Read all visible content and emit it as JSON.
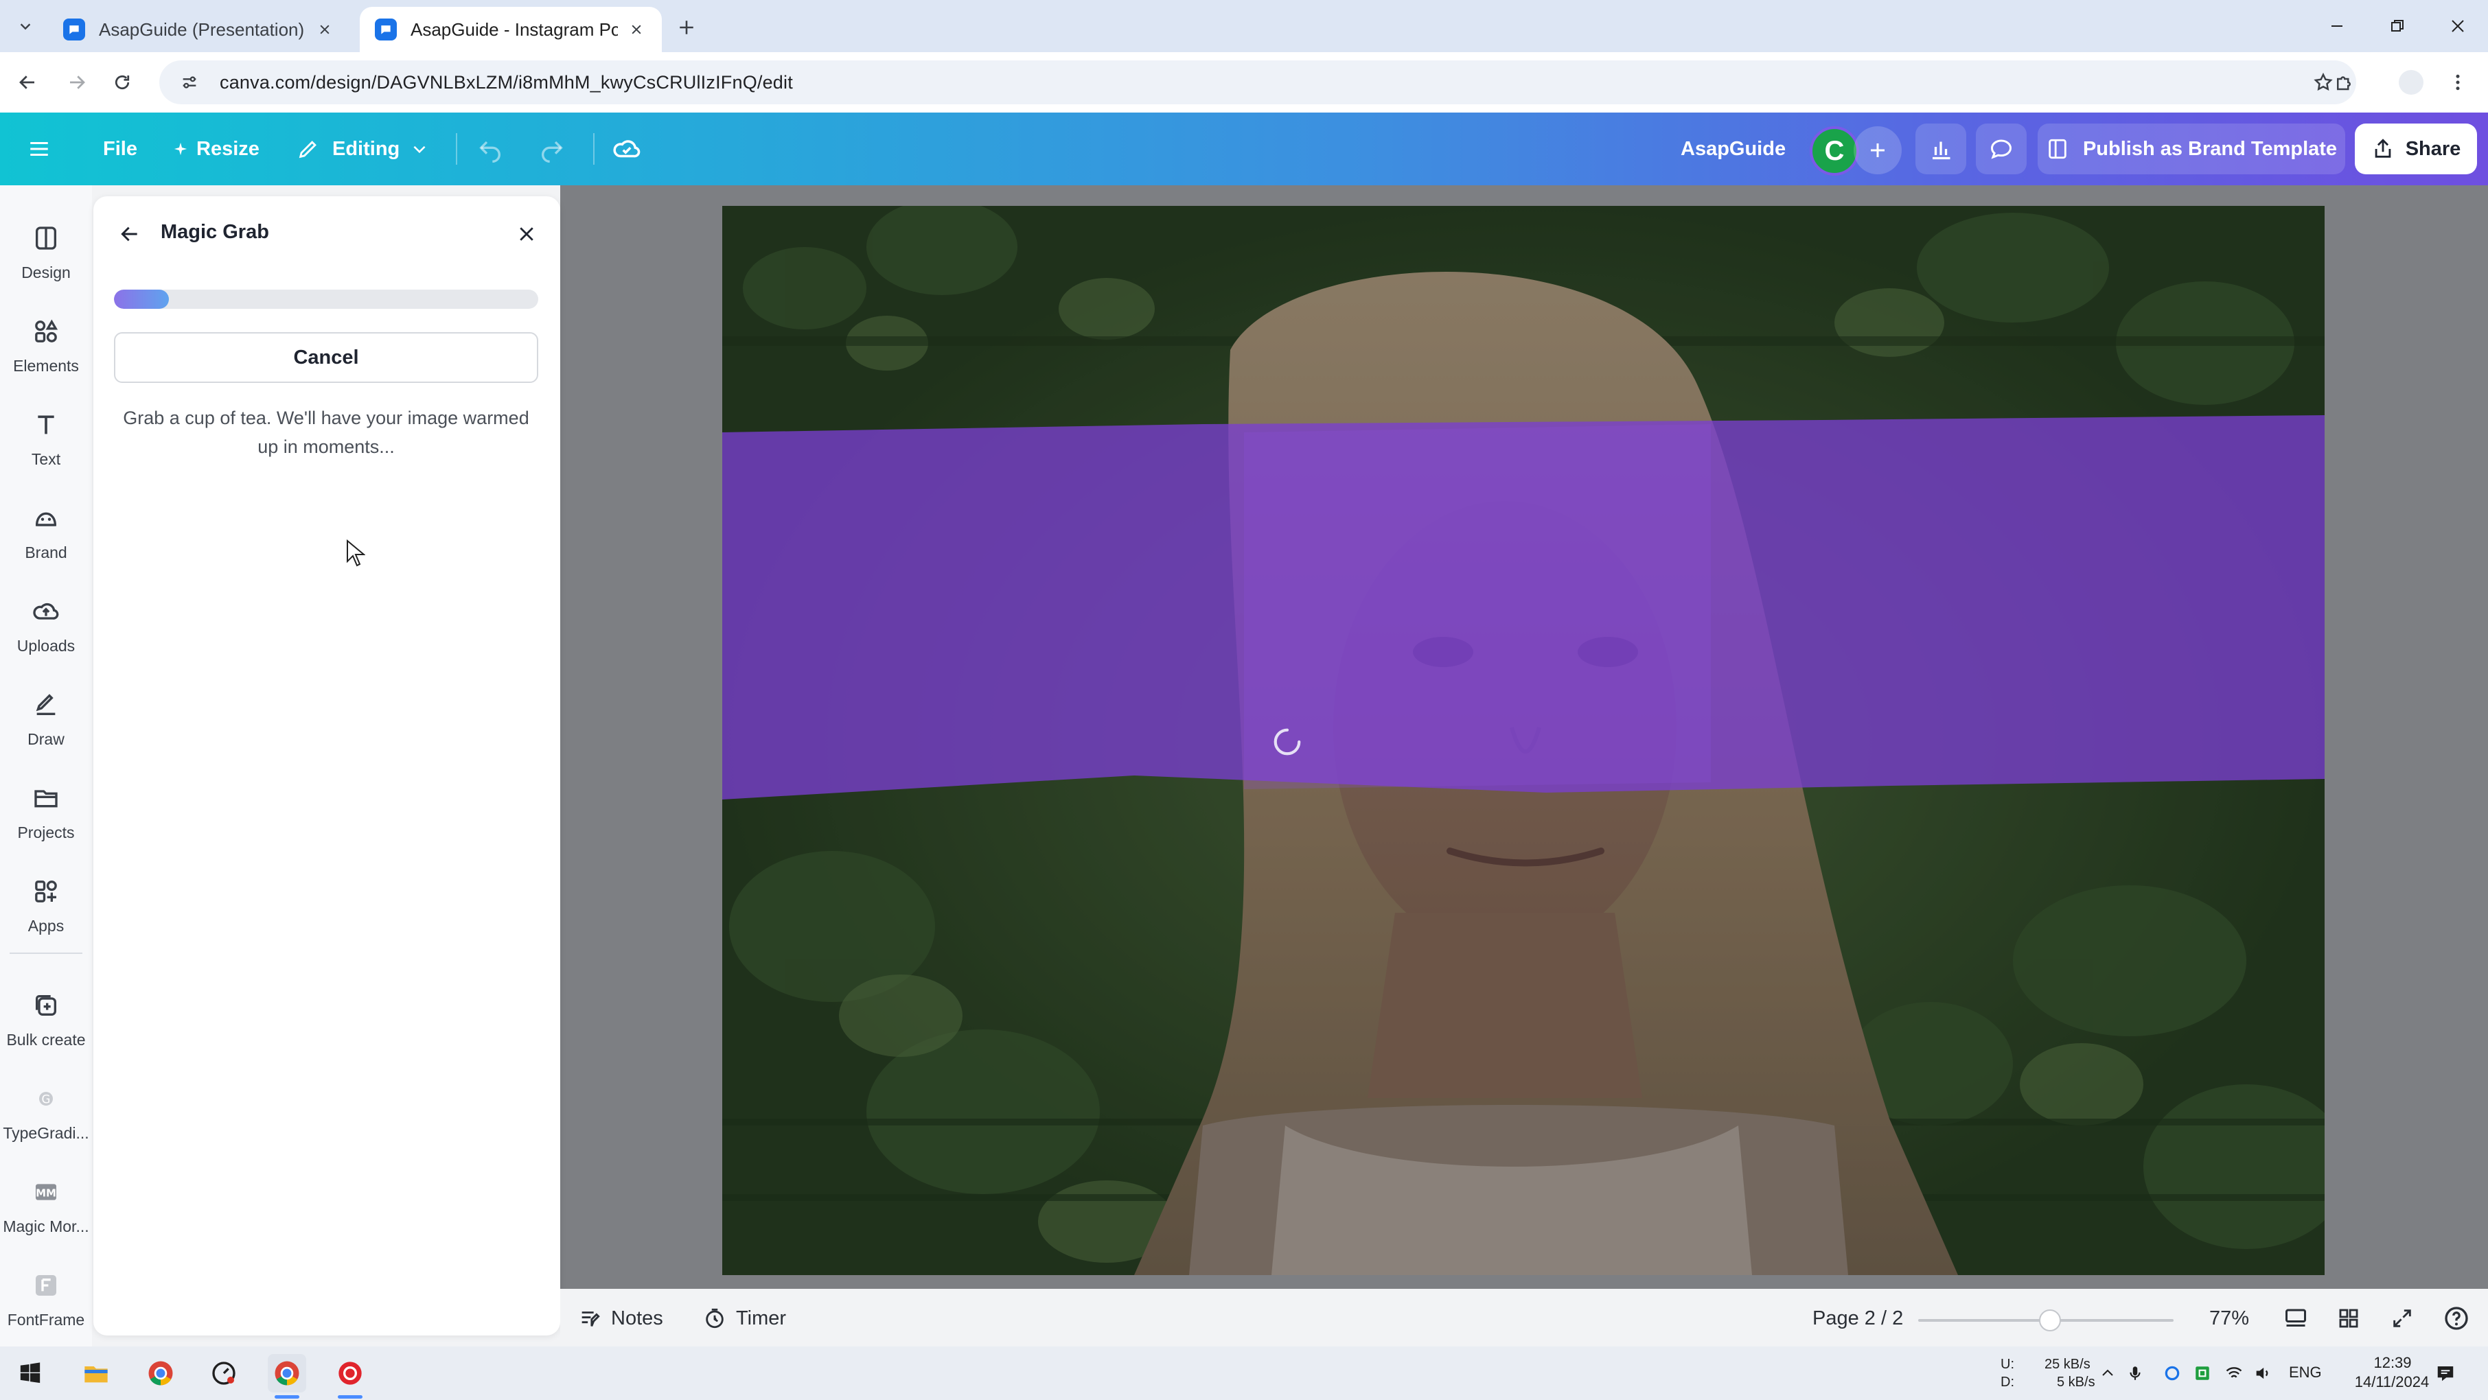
{
  "browser": {
    "tabs": [
      {
        "title": "AsapGuide (Presentation) - Pre",
        "active": false,
        "icon": "canva-favicon"
      },
      {
        "title": "AsapGuide - Instagram Post",
        "active": true,
        "icon": "canva-favicon"
      }
    ],
    "url": "canva.com/design/DAGVNLBxLZM/i8mMhM_kwyCsCRUlIzIFnQ/edit"
  },
  "header": {
    "file_label": "File",
    "resize_label": "Resize",
    "editing_label": "Editing",
    "project_name": "AsapGuide",
    "avatar_letter": "C",
    "publish_label": "Publish as Brand Template",
    "share_label": "Share",
    "colors": {
      "gradient_start": "#11c3d3",
      "gradient_end": "#6e4fe0"
    }
  },
  "rail": {
    "items": [
      {
        "label": "Design",
        "icon": "design-icon"
      },
      {
        "label": "Elements",
        "icon": "elements-icon"
      },
      {
        "label": "Text",
        "icon": "text-icon"
      },
      {
        "label": "Brand",
        "icon": "brand-icon"
      },
      {
        "label": "Uploads",
        "icon": "uploads-icon"
      },
      {
        "label": "Draw",
        "icon": "draw-icon"
      },
      {
        "label": "Projects",
        "icon": "projects-icon"
      },
      {
        "label": "Apps",
        "icon": "apps-icon"
      },
      {
        "label": "Bulk create",
        "icon": "bulk-create-icon"
      },
      {
        "label": "TypeGradi...",
        "icon": "typegradient-icon"
      },
      {
        "label": "Magic Mor...",
        "icon": "magic-morph-icon"
      },
      {
        "label": "FontFrame",
        "icon": "fontframe-icon"
      }
    ]
  },
  "panel": {
    "title": "Magic Grab",
    "progress": 0.13,
    "cancel_label": "Cancel",
    "message_line1": "Grab a cup of tea. We'll have your image warmed",
    "message_line2": "up in moments..."
  },
  "canvas": {
    "overlay_color": "#7a3fd0",
    "loading": true
  },
  "bottom": {
    "notes_label": "Notes",
    "timer_label": "Timer",
    "page_indicator": "Page 2 / 2",
    "zoom": "77%"
  },
  "taskbar": {
    "net_up_label": "U:",
    "net_down_label": "D:",
    "net_up": "25 kB/s",
    "net_down": "5 kB/s",
    "language": "ENG",
    "time": "12:39",
    "date": "14/11/2024"
  }
}
